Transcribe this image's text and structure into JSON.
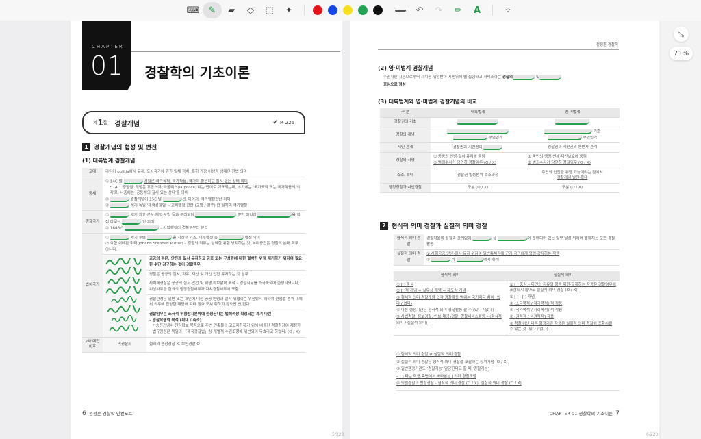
{
  "toolbar": {
    "tools": [
      "keyboard-icon",
      "pen-icon",
      "highlighter-icon",
      "eraser-icon",
      "lasso-select-icon",
      "magic-icon"
    ],
    "colors": [
      "#e8121b",
      "#1446e8",
      "#f6e01c",
      "#23a455",
      "#111111"
    ],
    "extra": [
      "line-width-icon",
      "undo-icon",
      "redo-icon",
      "pencil-icon",
      "text-style-icon",
      "apps-icon"
    ]
  },
  "side": {
    "zoom": "71%"
  },
  "counters": {
    "left": "5/223",
    "right": "6/223"
  },
  "left": {
    "chapter_label": "CHAPTER",
    "chapter_num": "01",
    "chapter_title": "경찰학의 기초이론",
    "section": {
      "prefix": "제",
      "num": "1",
      "suffix": "절",
      "title": "경찰개념",
      "page_ref": "P. 226"
    },
    "h1_num": "1",
    "h1": "경찰개념의 형성 및 변천",
    "h2": "(1) 대륙법계 경찰개념",
    "rows": {
      "ancient": {
        "label": "고대",
        "text": "라틴어 politia에서 유래, 도시국가에 관한 일체 정치, 특히 가장 이상적 상태인 헌법 의미"
      },
      "medieval": {
        "label": "중세",
        "l1a": "① 14C 말",
        "l1b": "경찰은 국가목적, 국가작용, 국가의 평온하고 질서 있는 상태 의미",
        "note": "* 14C '경찰권' 개념은 프랑스어 '라폴리스(la police)'라는 단어로 대표되는데, 초기에는 '국가목적 또는 국가작용의 의미'로, 나중에는 '공동체의 질서 있는 상태'를 의미",
        "l2a": "②",
        "l2b": "경찰개념이 15C 말",
        "l2c": "로 이어져, 국가행정전반 의미",
        "l3a": "③",
        "l3b": "세기 독일 '제국경찰법' – 교회행정 관한 (교황 / 영주) 한 일체의 국가행정"
      },
      "police_state": {
        "label": "경찰국가",
        "l1a": "①",
        "l1b": "세기 외교·군사·재정·사법 등과 분리되어",
        "l1c": "뿐만 아니라",
        "l1d": "을 직접 다루는",
        "l1e": "인 의미",
        "l2a": "② 1648년",
        "l2b": "– 사법행정이 경찰로부터 분리"
      },
      "rule_of_law": {
        "label": "법치국가",
        "l1a": "①",
        "l1b": "세기 후반",
        "l1c": "을 사상적 기초, 내무행정 중",
        "l1d": "행정 의미",
        "l2": "② 요한 쉬테판 퓌터(Johann Stephan Pütter) – 경찰의 직무는 임박한 위험 방지하는 것, 복리증진은 경찰의 본래 직무 아니다.",
        "s1": "공공의 평온, 안전과 질서 유지하고 공중 또는 구성원에 대한 절박한 위험 제거하기 위하여 필요한 수단 강구하는 것이 경찰책무",
        "s2": "경찰은 공공의 질서, 자유, 재산 및 개인 안전 유지하는 것 임무",
        "s3": "자치체경찰은 공공의 질서·안전 및 위생 확보함이 목적 – 경찰직무를 소극목적에 한정하였으나, 위생사무등 협의의 행정경찰사무가 자치경찰사무에 포함",
        "s4": "경찰관청은 일반 또는 개인에 대한 공공 안녕과 질서 위협하는 위험방지 위하여 현행법 범위 내에서 의무에 합당한 재량에 따라 필요 조치 취하지 않으면 안 된다.",
        "s5a": "경찰임무는 소극적 위험방지분야에 한정된다는 법해석상 확정되는 계기 마련",
        "s5b": "– 경찰작용의 목적 (확대 / 축소)",
        "s5c": "* 승전기념비 전망확보 목적으로 주변 건축물의 고도제한하기 위해 베를린 경찰청장이 제정한 법규명령은 독일의 「제국경찰법」상 개별적 수권조항에 위반되어 무효라고 하였다. (O / X)"
      },
      "postwar": {
        "label": "2차 대전이후",
        "sub": "비경찰화",
        "text": "협의의 행정경찰 X, 보안경찰 O"
      }
    },
    "footer_num": "6",
    "footer_text": "정정훈 경찰학 민컨노트"
  },
  "right": {
    "running_head": "정정훈 경찰학",
    "h2a": "(2) 영·미법계 경찰개념",
    "p1a": "주권자인 시민으로부터 자치권 위임받아 시민위해 법 집행하고 서비스하는",
    "p1b": "경찰의",
    "p1c": "및",
    "p1d": "중심으로 형성",
    "h2b": "(3) 대륙법계와 영·미법계 경찰개념의 비교",
    "cmp": {
      "head": [
        "구 분",
        "대륙법계",
        "영·미법계"
      ],
      "r1": "경찰권의 기초",
      "r2": "경찰의 개념",
      "r2b": "무엇인가",
      "r2c": "기준",
      "r3": "시민 관계",
      "r3a": "경찰권과 시민권의",
      "r3b": "경찰권과 시민권의 동반자 관계",
      "r4": "경찰의 사명",
      "r4a1": "① 공공의 안녕·질서 유지에 중점",
      "r4a2": "② 범죄수사가 당연히 경찰임무 (O / X)",
      "r4b1": "① 국민의 생명·신체·재산보호에 중점",
      "r4b2": "② 범죄수사가 당연히 경찰임무 (O / X)",
      "r5": "축소, 확대",
      "r5a": "경찰권 발동범위 축소과정",
      "r5b1": "주민의 안전을 위한 기능이라는 점에서",
      "r5b2": "경찰개념 발전·확대",
      "r6": "행정경찰과 사법경찰",
      "r6a": "구분 (O / X)",
      "r6b": "구분 (O / X)"
    },
    "h1_num": "2",
    "h1": "형식적 의미 경찰과 실질적 의미 경찰",
    "def": {
      "formal_label": "형식적 의미 경찰",
      "formal_a": "경찰작용의 성질과 관계없이",
      "formal_b": "상",
      "formal_c": "에 분배되어 있는 임무 달성 위하여 행해지는 모든 경찰활동",
      "material_label": "실질적 의미 경찰",
      "material_1": "① 사회공공 안녕·질서 유지 위하여 일반통치권에 근거 국민에게 명령·강제하는 작용",
      "material_2a": "②",
      "material_2b": "의",
      "material_2c": "에서 유래"
    },
    "cols": [
      "형식적 의미",
      "실질적 의미"
    ],
    "formal_list": [
      "① [ ] 중심",
      "② [ ]적 개념 = 실무상 개념 = 제도상 개념",
      "③ 형식적 의미 경찰개념 입각 경찰활동 범위는 국가마다 차이 (있다 / 없다)",
      "④ 다른 행정기관은 형식적 의미 경찰활동 할 수 (있다 / 없다)",
      "⑤ 사법경찰, 정보경찰, 안보(대공)경찰, 경찰서비스활동 – (형식적 의미 / 실질적 의미)"
    ],
    "material_list": [
      "① [ ] 중심 – 타인의 자유와 행동 제한·규제하는 작용은 경찰임무에 포함되지 않아도 실질적 의미 경찰 (O / X)",
      "② [ ] · [ ] 개념",
      "③ (소극목적 / 적극목적) 적 작용",
      "④ (국가목적 / 사회목적) 적 작용",
      "⑤ (권력적 / 비권력적) 작용",
      "⑥ 경찰 아닌 다른 행정기관 작용은 실질적 의미 경찰에 포함시킬 수 있는 것 (있다 / 없다)"
    ],
    "bottom": [
      "① 형식적 의미 경찰 ≠ 실질적 의미 경찰",
      "② 실질적 의미 경찰은 형식적 의미 경찰을 포괄하는 상위개념 (O / X)",
      "③ 일반행정기관도 '경찰기능' 담당한다고 할 때 '경찰기능'",
      "– [ ] 라는 작용 측면에서 바라본 [ ] 의미 경찰개념",
      "④ 의원경찰과 법정경찰 - 형식적 의미 경찰 (O / X), 실질적 의미 경찰 (O / X)"
    ],
    "footer_text": "CHAPTER 01 경찰학의 기초이론",
    "footer_num": "7"
  }
}
